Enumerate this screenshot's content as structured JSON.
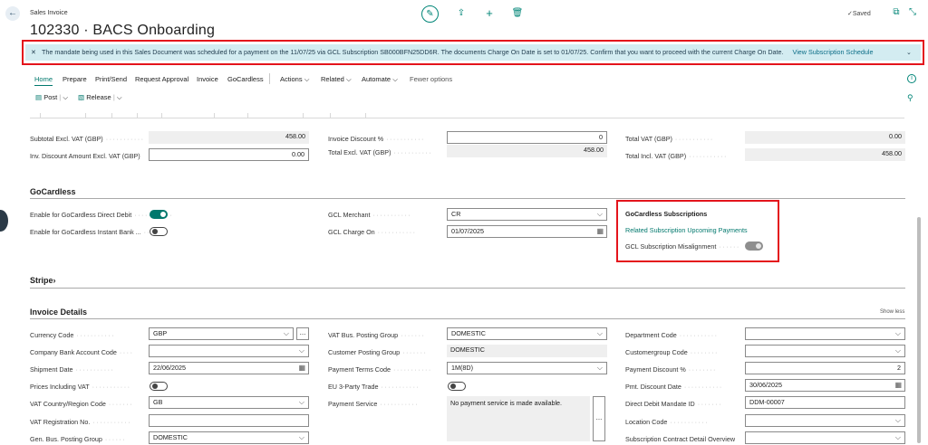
{
  "header": {
    "breadcrumb": "Sales Invoice",
    "title": "102330 · BACS Onboarding",
    "saved_label": "Saved",
    "icons": [
      "back-arrow-icon",
      "edit-pencil-icon",
      "share-icon",
      "plus-icon",
      "trash-icon",
      "open-new-window-icon",
      "collapse-icon"
    ]
  },
  "banner": {
    "close_glyph": "✕",
    "message": "The mandate being used in this Sales Document was scheduled for a payment on the 11/07/25 via GCL Subscription SB000BFN25DD6R. The documents Charge On Date is set to 01/07/25. Confirm that you want to proceed with the current Charge On Date.",
    "link": "View Subscription Schedule",
    "chevron": "⌄"
  },
  "menu": {
    "home": "Home",
    "prepare": "Prepare",
    "print_send": "Print/Send",
    "request_approval": "Request Approval",
    "invoice": "Invoice",
    "gocardless": "GoCardless",
    "actions": "Actions",
    "related": "Related",
    "automate": "Automate",
    "fewer_options": "Fewer options",
    "post": "Post",
    "release": "Release",
    "chevron": "⌵"
  },
  "totals": {
    "subtotal_label": "Subtotal Excl. VAT (GBP)",
    "subtotal_value": "458.00",
    "inv_discount_amount_label": "Inv. Discount Amount Excl. VAT (GBP)",
    "inv_discount_amount_value": "0.00",
    "invoice_discount_pct_label": "Invoice Discount %",
    "invoice_discount_pct_value": "0",
    "total_excl_vat_label": "Total Excl. VAT (GBP)",
    "total_excl_vat_value": "458.00",
    "total_vat_label": "Total VAT (GBP)",
    "total_vat_value": "0.00",
    "total_incl_vat_label": "Total Incl. VAT (GBP)",
    "total_incl_vat_value": "458.00"
  },
  "gocardless": {
    "section_title": "GoCardless",
    "enable_dd_label": "Enable for GoCardless Direct Debit",
    "enable_dd_on": true,
    "enable_instant_label": "Enable for GoCardless Instant Bank ...",
    "enable_instant_on": false,
    "merchant_label": "GCL Merchant",
    "merchant_value": "CR",
    "charge_on_label": "GCL Charge On",
    "charge_on_value": "01/07/2025",
    "subscriptions_title": "GoCardless Subscriptions",
    "related_link": "Related Subscription Upcoming Payments",
    "misalignment_label": "GCL Subscription Misalignment",
    "misalignment_on": true
  },
  "stripe": {
    "section_title": "Stripe",
    "chevron": "›"
  },
  "invoice_details": {
    "section_title": "Invoice Details",
    "show_less": "Show less",
    "currency_code_label": "Currency Code",
    "currency_code_value": "GBP",
    "company_bank_label": "Company Bank Account Code",
    "company_bank_value": "",
    "shipment_date_label": "Shipment Date",
    "shipment_date_value": "22/06/2025",
    "prices_incl_vat_label": "Prices Including VAT",
    "prices_incl_vat_on": false,
    "vat_country_label": "VAT Country/Region Code",
    "vat_country_value": "GB",
    "vat_reg_label": "VAT Registration No.",
    "vat_reg_value": "",
    "gen_bus_label": "Gen. Bus. Posting Group",
    "gen_bus_value": "DOMESTIC",
    "vat_bus_label": "VAT Bus. Posting Group",
    "vat_bus_value": "DOMESTIC",
    "customer_posting_label": "Customer Posting Group",
    "customer_posting_value": "DOMESTIC",
    "payment_terms_label": "Payment Terms Code",
    "payment_terms_value": "1M(8D)",
    "eu_trade_label": "EU 3-Party Trade",
    "eu_trade_on": false,
    "payment_service_label": "Payment Service",
    "payment_service_value": "No payment service is made available.",
    "department_label": "Department Code",
    "department_value": "",
    "customergroup_label": "Customergroup Code",
    "customergroup_value": "",
    "payment_discount_label": "Payment Discount %",
    "payment_discount_value": "2",
    "pmt_discount_date_label": "Pmt. Discount Date",
    "pmt_discount_date_value": "30/06/2025",
    "direct_debit_label": "Direct Debit Mandate ID",
    "direct_debit_value": "DDM-00007",
    "location_label": "Location Code",
    "location_value": "",
    "subscription_contract_label": "Subscription Contract Detail Overview",
    "subscription_contract_value": ""
  },
  "glyphs": {
    "dots": "···········",
    "ellipsis": "...",
    "chevron_down": "⌵",
    "calendar": "▦"
  },
  "colors": {
    "accent": "#00786d",
    "banner_bg": "#d3ecf1",
    "highlight_red": "#e4141c"
  }
}
